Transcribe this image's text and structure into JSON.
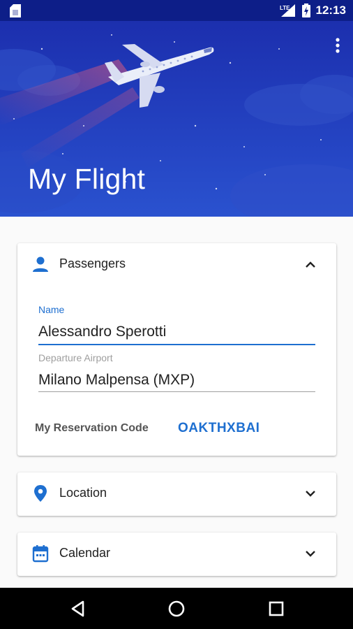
{
  "status_bar": {
    "time": "12:13",
    "network": "LTE"
  },
  "header": {
    "title": "My Flight"
  },
  "passengers_card": {
    "title": "Passengers",
    "name_label": "Name",
    "name_value": "Alessandro Sperotti",
    "airport_label": "Departure Airport",
    "airport_value": "Milano Malpensa (MXP)",
    "reservation_label": "My Reservation Code",
    "reservation_code": "OAKTHXBAI"
  },
  "location_card": {
    "title": "Location"
  },
  "calendar_card": {
    "title": "Calendar"
  },
  "colors": {
    "accent": "#1e6fd0",
    "header_bg": "#2443c2",
    "status_bar_bg": "#0d1e88"
  },
  "icons": [
    "sim-card-icon",
    "signal-icon",
    "battery-icon",
    "more-vert-icon",
    "person-icon",
    "chevron-up-icon",
    "location-pin-icon",
    "chevron-down-icon",
    "calendar-icon",
    "back-icon",
    "home-icon",
    "recents-icon"
  ]
}
